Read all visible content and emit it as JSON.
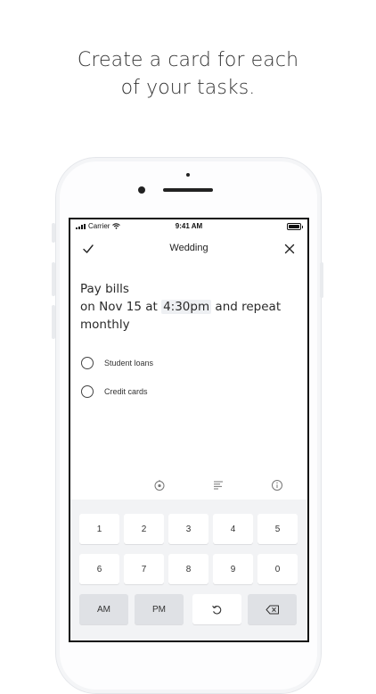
{
  "headline": {
    "line1": "Create a card for each",
    "line2": "of your tasks."
  },
  "status_bar": {
    "carrier": "Carrier",
    "time": "9:41 AM"
  },
  "nav": {
    "title": "Wedding",
    "check_icon": "checkmark-icon",
    "close_icon": "close-icon"
  },
  "task": {
    "title": "Pay bills",
    "line2_pre": "on Nov 15 at ",
    "time_highlight": "4:30pm",
    "line2_post": " and repeat",
    "line3": "monthly"
  },
  "subtasks": [
    {
      "label": "Student loans"
    },
    {
      "label": "Credit cards"
    }
  ],
  "toolbar": {
    "icons": [
      "timer-icon",
      "notes-icon",
      "info-icon"
    ]
  },
  "keyboard": {
    "row1": [
      "1",
      "2",
      "3",
      "4",
      "5"
    ],
    "row2": [
      "6",
      "7",
      "8",
      "9",
      "0"
    ],
    "row3": [
      "AM",
      "PM"
    ],
    "undo_icon": "undo-icon",
    "delete_icon": "backspace-icon"
  },
  "colors": {
    "screen_border": "#111111",
    "keyboard_bg": "#f2f3f5",
    "key_dark": "#dfe1e5",
    "highlight": "#eef0f3"
  }
}
